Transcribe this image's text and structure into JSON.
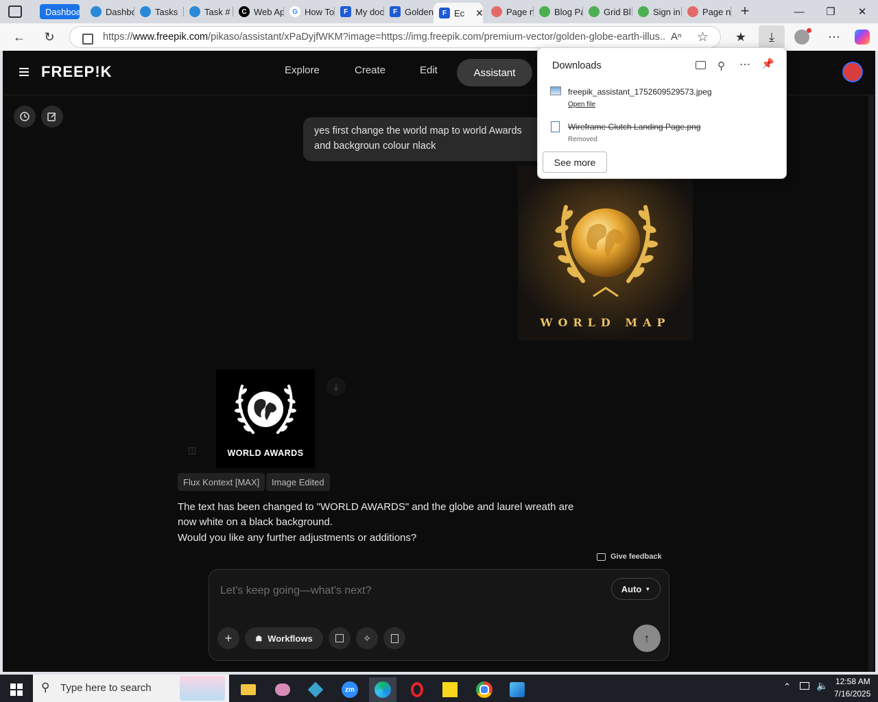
{
  "browser": {
    "tabs": [
      {
        "label": "Dashboa",
        "fav_color": "#1a73e8"
      },
      {
        "label": "Dashbo",
        "fav_color": "#2b8ad6"
      },
      {
        "label": "Tasks",
        "fav_color": "#2b8ad6"
      },
      {
        "label": "Task #",
        "fav_color": "#2b8ad6"
      },
      {
        "label": "Web Ap",
        "fav_color": "#000000"
      },
      {
        "label": "How To",
        "fav_color": "#e0e0e0"
      },
      {
        "label": "My doc",
        "fav_color": "#1e5bd6"
      },
      {
        "label": "Golden",
        "fav_color": "#1e5bd6"
      },
      {
        "label": "Ec",
        "fav_color": "#1e5bd6"
      },
      {
        "label": "Page n",
        "fav_color": "#e26a6a"
      },
      {
        "label": "Blog Pa",
        "fav_color": "#4caf50"
      },
      {
        "label": "Grid Bl",
        "fav_color": "#4caf50"
      },
      {
        "label": "Sign in",
        "fav_color": "#4caf50"
      },
      {
        "label": "Page n",
        "fav_color": "#e26a6a"
      }
    ],
    "url_prefix": "https://",
    "url_host": "www.freepik.com",
    "url_rest": "/pikaso/assistant/xPaDyjfWKM?image=https://img.freepik.com/premium-vector/golden-globe-earth-illus..."
  },
  "app": {
    "logo": "FREEP!K",
    "nav": [
      "Explore",
      "Create",
      "Edit",
      "Assistant"
    ],
    "user_message": "yes first change the world map to world Awards and backgroun colour nlack",
    "gold_image_caption": "WORLD MAP",
    "white_image_caption": "WORLD AWARDS",
    "tags": [
      "Flux Kontext [MAX]",
      "Image Edited"
    ],
    "response_line1": "The text has been changed to \"WORLD AWARDS\" and the globe and laurel wreath are",
    "response_line2": "now white on a black background.",
    "response_line3": "Would you like any further adjustments or additions?",
    "feedback": "Give feedback",
    "composer_placeholder": "Let's keep going—what's next?",
    "mode": "Auto",
    "workflows": "Workflows"
  },
  "downloads": {
    "title": "Downloads",
    "items": [
      {
        "name": "freepik_assistant_1752609529573.jpeg",
        "action": "Open file"
      },
      {
        "name": "Wireframe Clutch Landing Page.png",
        "status": "Removed"
      }
    ],
    "see_more": "See more"
  },
  "taskbar": {
    "search_placeholder": "Type here to search",
    "time": "12:58 AM",
    "date": "7/16/2025"
  }
}
